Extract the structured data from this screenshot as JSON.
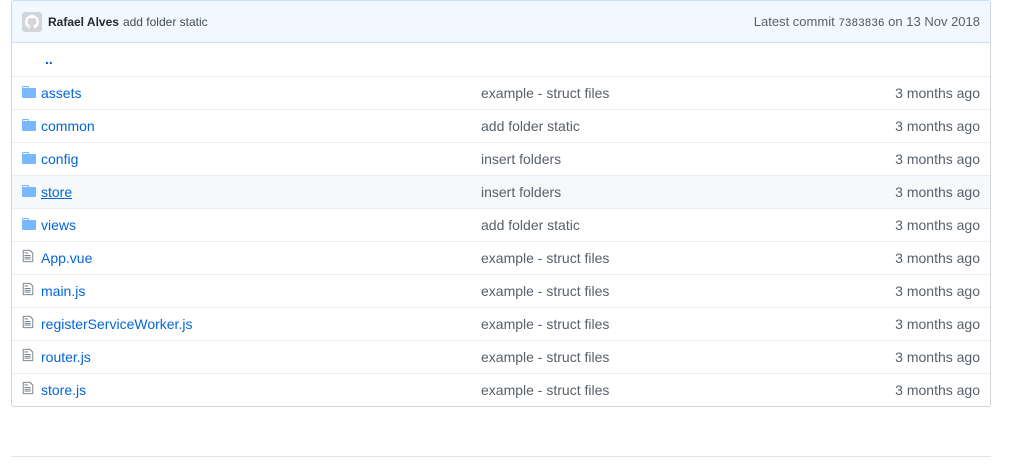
{
  "commit": {
    "author": "Rafael Alves",
    "message": "add folder static",
    "latest_label": "Latest commit",
    "sha": "7383836",
    "on_label": "on",
    "date": "13 Nov 2018"
  },
  "up_link": "..",
  "files": [
    {
      "type": "dir",
      "icon": "folder-icon",
      "name": "assets",
      "message": "example - struct files",
      "age": "3 months ago"
    },
    {
      "type": "dir",
      "icon": "folder-icon",
      "name": "common",
      "message": "add folder static",
      "age": "3 months ago"
    },
    {
      "type": "dir",
      "icon": "folder-icon",
      "name": "config",
      "message": "insert folders",
      "age": "3 months ago"
    },
    {
      "type": "dir",
      "icon": "folder-icon",
      "name": "store",
      "message": "insert folders",
      "age": "3 months ago"
    },
    {
      "type": "dir",
      "icon": "folder-icon",
      "name": "views",
      "message": "add folder static",
      "age": "3 months ago"
    },
    {
      "type": "file",
      "icon": "file-icon",
      "name": "App.vue",
      "message": "example - struct files",
      "age": "3 months ago"
    },
    {
      "type": "file",
      "icon": "file-icon",
      "name": "main.js",
      "message": "example - struct files",
      "age": "3 months ago"
    },
    {
      "type": "file",
      "icon": "file-icon",
      "name": "registerServiceWorker.js",
      "message": "example - struct files",
      "age": "3 months ago"
    },
    {
      "type": "file",
      "icon": "file-icon",
      "name": "router.js",
      "message": "example - struct files",
      "age": "3 months ago"
    },
    {
      "type": "file",
      "icon": "file-icon",
      "name": "store.js",
      "message": "example - struct files",
      "age": "3 months ago"
    }
  ],
  "colors": {
    "link": "#0366d6",
    "folder_icon": "#79b8ff",
    "file_icon": "#6a737d",
    "header_bg": "#f1f8ff",
    "row_hover": "#f6f8fa"
  }
}
